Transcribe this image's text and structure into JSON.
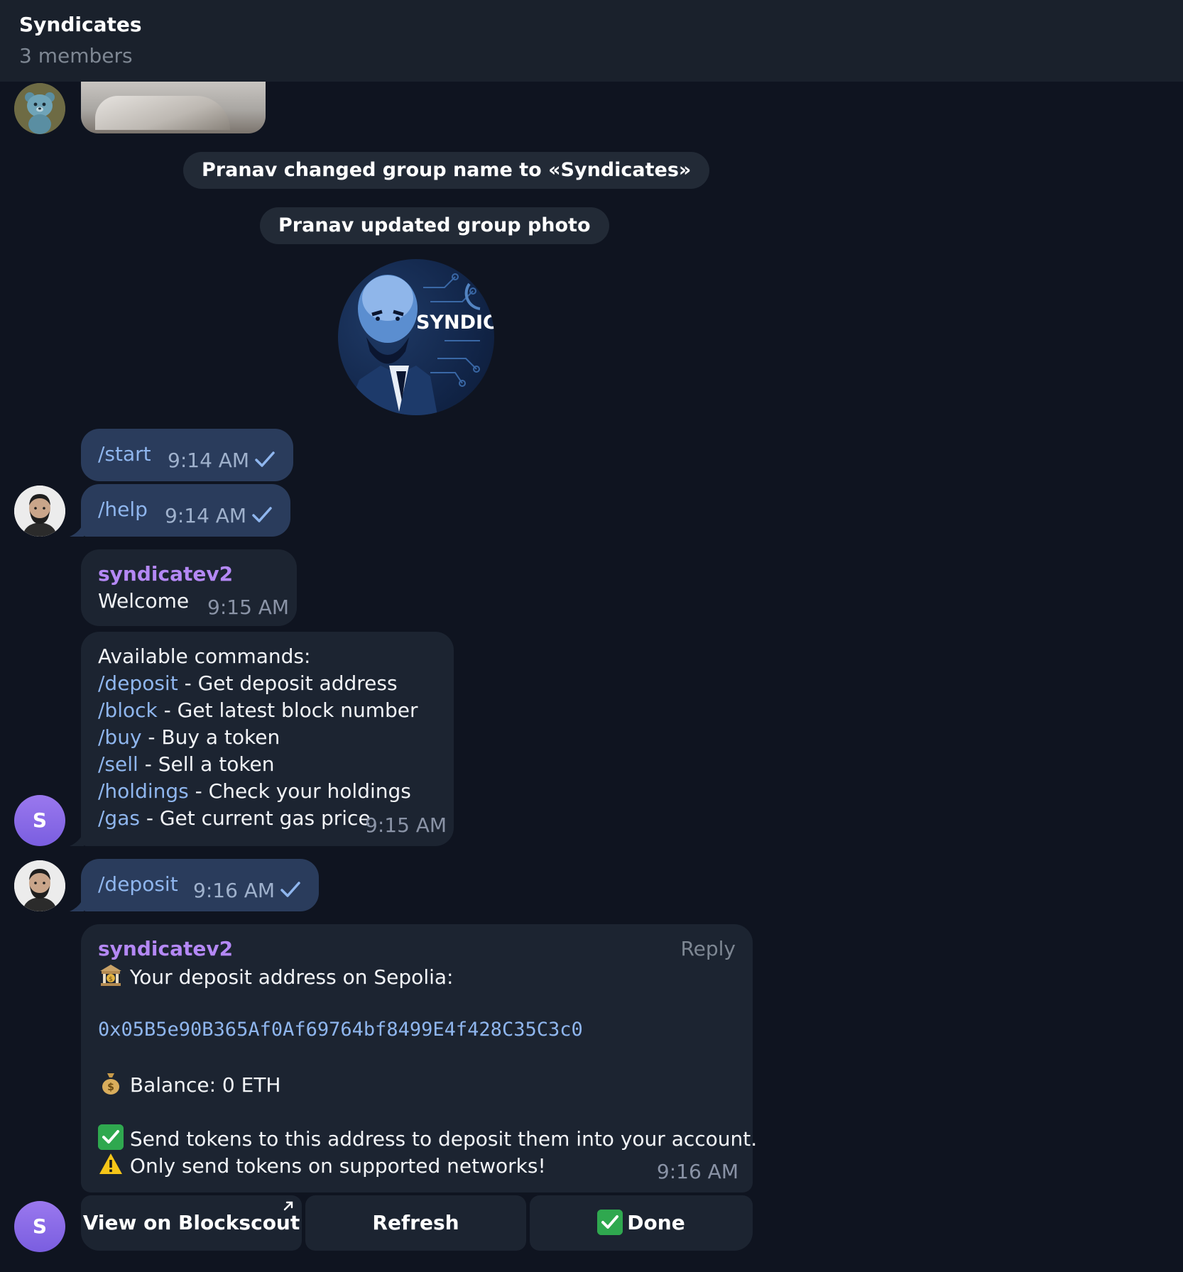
{
  "header": {
    "title": "Syndicates",
    "subtitle": "3 members"
  },
  "service_messages": {
    "rename": "Pranav changed group name to «Syndicates»",
    "photo": "Pranav updated group photo"
  },
  "group_photo": {
    "text": "SYNDICA"
  },
  "messages": {
    "start": {
      "text": "/start",
      "time": "9:14 AM"
    },
    "help": {
      "text": "/help",
      "time": "9:14 AM"
    },
    "welcome": {
      "sender": "syndicatev2",
      "text": "Welcome",
      "time": "9:15 AM"
    },
    "commands": {
      "intro": "Available commands:",
      "items": [
        {
          "cmd": "/deposit",
          "desc": " - Get deposit address"
        },
        {
          "cmd": "/block",
          "desc": " - Get latest block number"
        },
        {
          "cmd": "/buy",
          "desc": " - Buy a token"
        },
        {
          "cmd": "/sell",
          "desc": " - Sell a token"
        },
        {
          "cmd": "/holdings",
          "desc": " - Check your holdings"
        },
        {
          "cmd": "/gas",
          "desc": " - Get current gas price"
        }
      ],
      "time": "9:15 AM"
    },
    "deposit_cmd": {
      "text": "/deposit",
      "time": "9:16 AM"
    },
    "deposit_reply": {
      "sender": "syndicatev2",
      "reply_label": "Reply",
      "line1": "Your deposit address on Sepolia:",
      "address": "0x05B5e90B365Af0Af69764bf8499E4f428C35C3c0",
      "balance": "Balance: 0 ETH",
      "note1": "Send tokens to this address to deposit them into your account.",
      "note2": "Only send tokens on supported networks!",
      "time": "9:16 AM",
      "icons": [
        "bank-icon",
        "money-bag-icon",
        "check-mark-icon",
        "warning-icon"
      ]
    }
  },
  "keyboard": {
    "blockscout": "View on Blockscout",
    "refresh": "Refresh",
    "done": "Done"
  },
  "avatars": {
    "bot_initial": "S"
  },
  "colors": {
    "background": "#0f1420",
    "header": "#1a212c",
    "outgoing_bubble": "#2a3c5c",
    "incoming_bubble": "#1c2431",
    "link": "#8fb6ee",
    "sender": "#b488f5",
    "avatar_bot": "#8a6aea"
  }
}
